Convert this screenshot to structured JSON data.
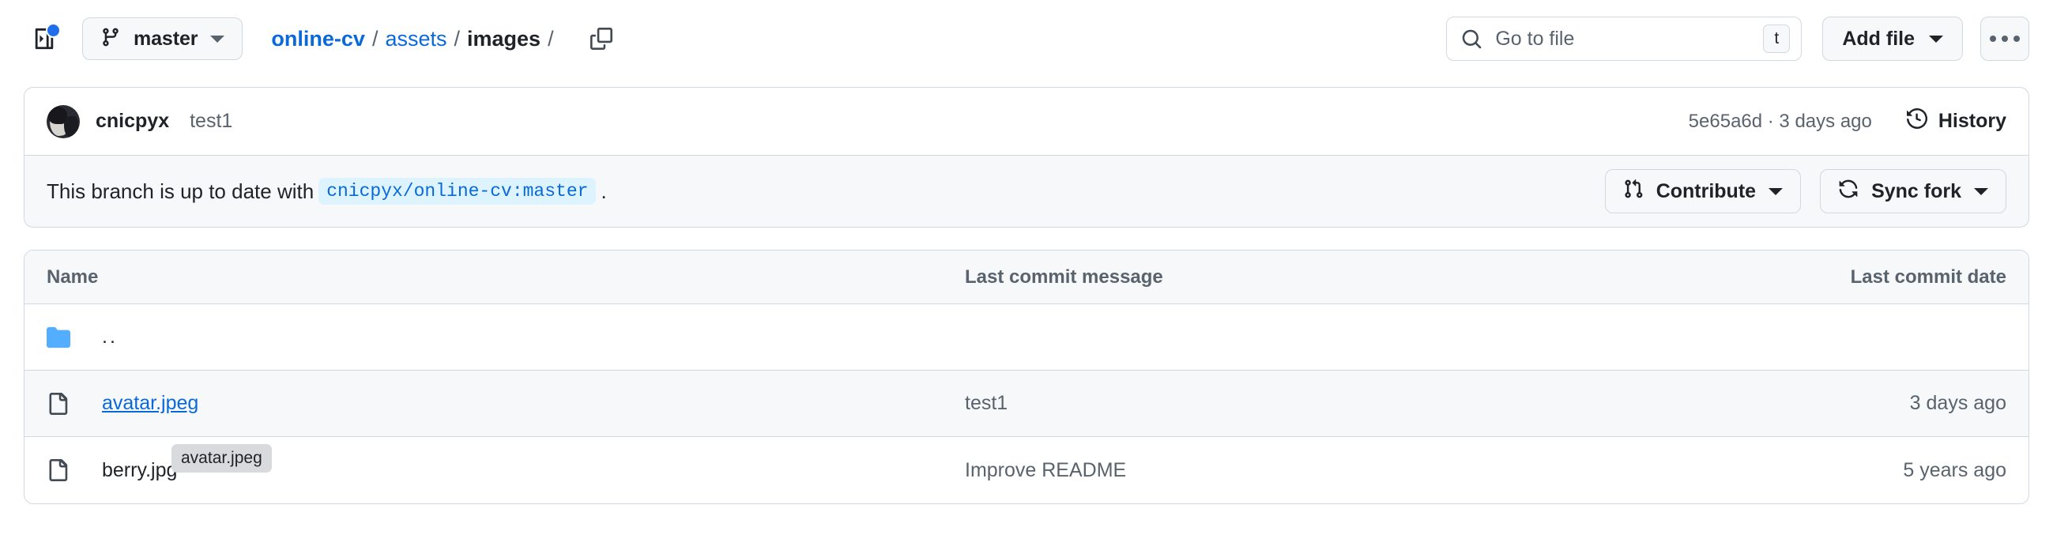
{
  "topbar": {
    "sidebar_toggle_icon": "sidebar-expand-icon",
    "notification_dot_color": "#1f6feb",
    "branch": {
      "icon": "git-branch-icon",
      "label": "master",
      "caret_icon": "chevron-down-icon"
    },
    "breadcrumb": {
      "repo": "online-cv",
      "sep1": "/",
      "folder1": "assets",
      "sep2": "/",
      "folder2": "images",
      "sep3": "/",
      "copy_icon": "copy-path-icon"
    },
    "search": {
      "icon": "search-icon",
      "placeholder": "Go to file",
      "value": "",
      "shortcut": "t"
    },
    "add_file": {
      "label": "Add file",
      "caret_icon": "chevron-down-icon"
    },
    "kebab": {
      "icon": "kebab-horizontal-icon"
    }
  },
  "commit_bar": {
    "avatar": "user-avatar",
    "author": "cnicpyx",
    "message": "test1",
    "meta": "5e65a6d · 3 days ago",
    "history": {
      "icon": "clock-history-icon",
      "label": "History"
    }
  },
  "branch_status": {
    "text_before": "This branch is up to date with",
    "ref": "cnicpyx/online-cv:master",
    "text_after": ".",
    "contribute": {
      "icon": "git-pull-request-icon",
      "label": "Contribute",
      "caret_icon": "chevron-down-icon"
    },
    "sync_fork": {
      "icon": "sync-icon",
      "label": "Sync fork",
      "caret_icon": "chevron-down-icon"
    }
  },
  "file_table": {
    "headers": {
      "name": "Name",
      "message": "Last commit message",
      "date": "Last commit date"
    },
    "rows": [
      {
        "icon": "folder-icon",
        "name": "..",
        "message": "",
        "date": ""
      },
      {
        "icon": "file-icon",
        "name": "avatar.jpeg",
        "message": "test1",
        "date": "3 days ago"
      },
      {
        "icon": "file-icon",
        "name": "berry.jpg",
        "message": "Improve README",
        "date": "5 years ago"
      }
    ]
  },
  "tooltip": {
    "text": "avatar.jpeg"
  },
  "colors": {
    "link": "#0969da",
    "folder": "#54aeff",
    "muted": "#59636e",
    "border": "#d1d9e0",
    "surface": "#f6f8fa",
    "code_chip_bg": "#ddf4ff"
  }
}
